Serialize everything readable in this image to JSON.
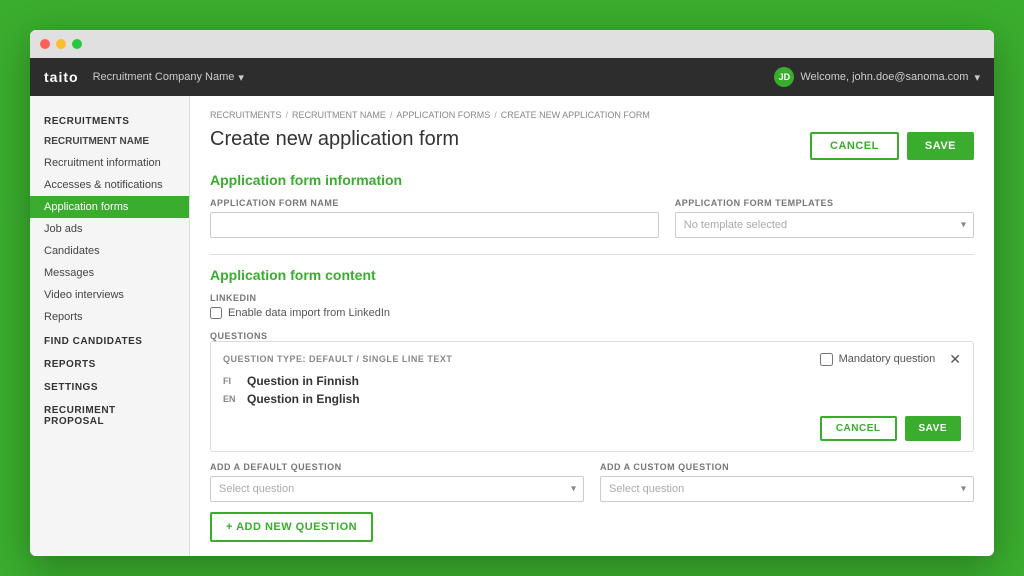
{
  "app": {
    "logo": "taito",
    "company_name": "Recruitment Company Name",
    "user_welcome": "Welcome, john.doe@sanoma.com"
  },
  "breadcrumb": {
    "items": [
      "RECRUITMENTS",
      "RECRUITMENT NAME",
      "APPLICATION FORMS",
      "CREATE NEW APPLICATION FORM"
    ],
    "separators": [
      "/",
      "/",
      "/"
    ]
  },
  "page": {
    "title": "Create new application form",
    "cancel_label": "CANCEL",
    "save_label": "SAVE"
  },
  "sidebar": {
    "sections": [
      {
        "title": "RECRUITMENTS",
        "items": [
          {
            "label": "RECRUITMENT NAME",
            "level": "bold",
            "active": false
          },
          {
            "label": "Recruitment information",
            "active": false
          },
          {
            "label": "Accesses & notifications",
            "active": false
          },
          {
            "label": "Application forms",
            "active": true
          },
          {
            "label": "Job ads",
            "active": false
          },
          {
            "label": "Candidates",
            "active": false
          },
          {
            "label": "Messages",
            "active": false
          },
          {
            "label": "Video interviews",
            "active": false
          },
          {
            "label": "Reports",
            "active": false
          }
        ]
      },
      {
        "title": "FIND CANDIDATES"
      },
      {
        "title": "REPORTS"
      },
      {
        "title": "SETTINGS"
      },
      {
        "title": "RECURIMENT PROPOSAL"
      }
    ]
  },
  "form_info": {
    "section_title": "Application form information",
    "name_label": "APPLICATION FORM NAME",
    "name_placeholder": "",
    "template_label": "APPLICATION FORM TEMPLATES",
    "template_placeholder": "No template selected"
  },
  "form_content": {
    "section_title": "Application form content",
    "linkedin_label": "LINKEDIN",
    "linkedin_checkbox_label": "Enable data import from LinkedIn",
    "questions_label": "QUESTIONS",
    "question_card": {
      "type_label": "QUESTION TYPE: DEFAULT / SINGLE LINE TEXT",
      "mandatory_label": "Mandatory question",
      "fi_label": "FI",
      "fi_question": "Question in Finnish",
      "en_label": "EN",
      "en_question": "Question in English",
      "cancel_label": "CANCEL",
      "save_label": "SAVE"
    },
    "add_default_label": "ADD A DEFAULT QUESTION",
    "add_default_placeholder": "Select question",
    "add_custom_label": "ADD A CUSTOM QUESTION",
    "add_custom_placeholder": "Select question",
    "add_new_label": "+ ADD NEW QUESTION"
  }
}
